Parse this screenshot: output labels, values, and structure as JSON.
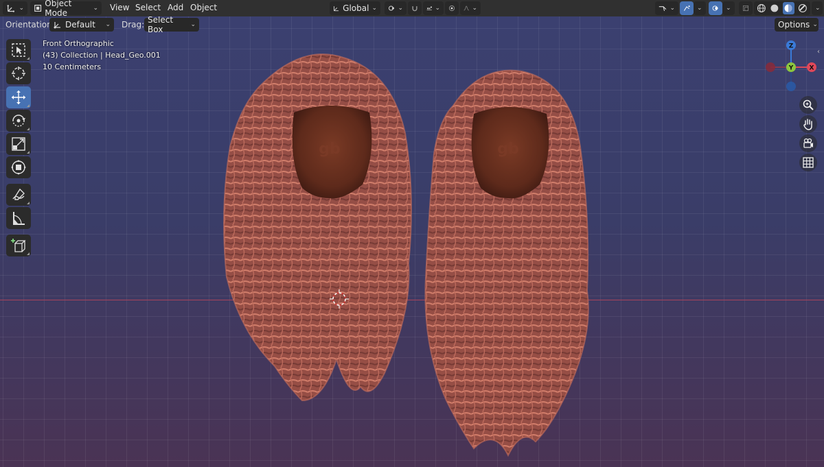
{
  "header": {
    "mode_label": "Object Mode",
    "menus": [
      "View",
      "Select",
      "Add",
      "Object"
    ],
    "transform_orientation": "Global"
  },
  "tool_settings": {
    "orientation_label": "Orientation:",
    "orientation_value": "Default",
    "drag_label": "Drag:",
    "drag_value": "Select Box",
    "options_label": "Options"
  },
  "viewport": {
    "view_name": "Front Orthographic",
    "collection_info": "(43) Collection | Head_Geo.001",
    "scale_label": "10 Centimeters",
    "head_logo_text": "gb"
  },
  "gizmo": {
    "z": "Z",
    "y": "Y",
    "x": "X"
  },
  "colors": {
    "hair_dark": "#7e4038",
    "hair_mid": "#a8584a",
    "hair_light": "#d8806a",
    "head": "#5e2a1b",
    "accent": "#4772b3",
    "x_axis_line": "#a8435a"
  },
  "icons": {
    "editor_type": "axis-icon",
    "toolbar": [
      "select-box-icon",
      "cursor-icon",
      "move-icon",
      "rotate-icon",
      "scale-icon",
      "transform-icon",
      "annotate-icon",
      "measure-icon",
      "add-cube-icon"
    ],
    "navigation": [
      "zoom-icon",
      "pan-hand-icon",
      "camera-icon",
      "grid-icon"
    ]
  }
}
